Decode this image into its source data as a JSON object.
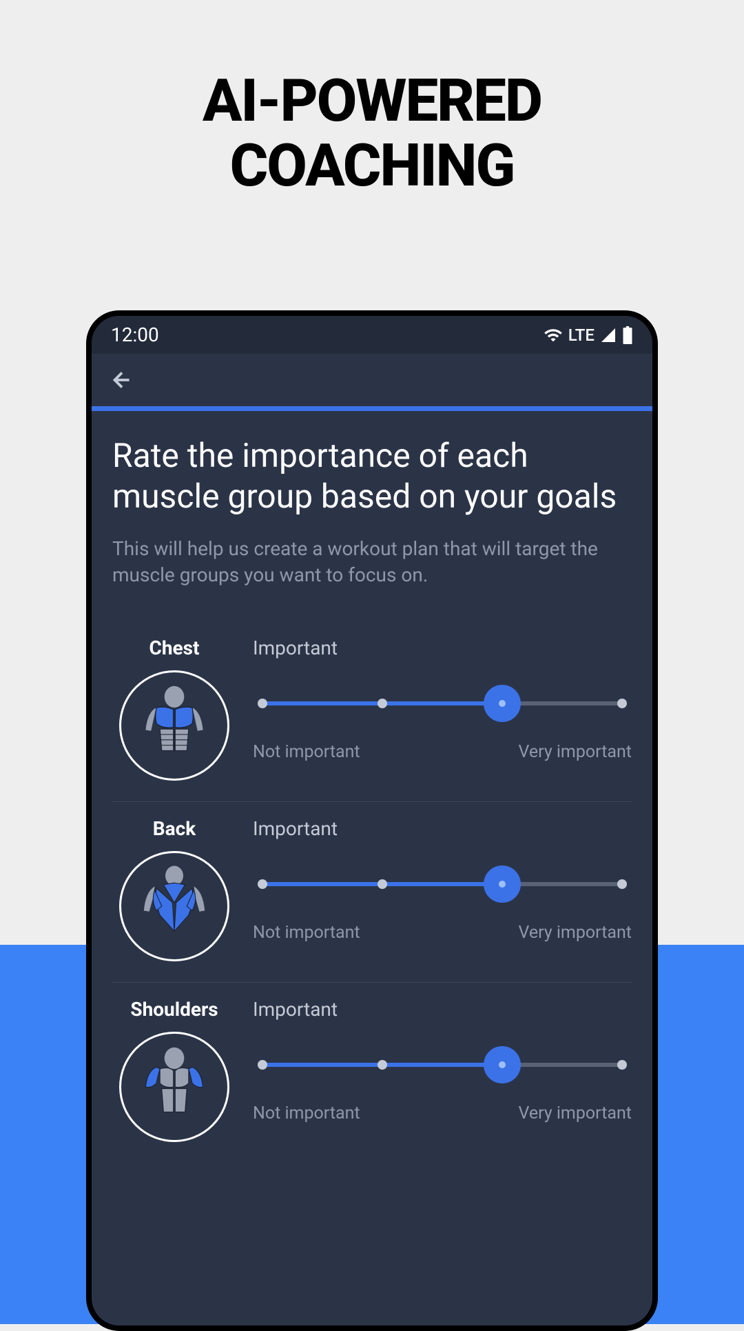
{
  "promo": {
    "title_line1": "AI-POWERED",
    "title_line2": "COACHING"
  },
  "status_bar": {
    "time": "12:00",
    "network": "LTE"
  },
  "screen": {
    "heading": "Rate the importance of each muscle group based on your goals",
    "subtitle": "This will help us create a workout plan that will target the muscle groups you want to focus on.",
    "slider_min_label": "Not important",
    "slider_max_label": "Very important"
  },
  "muscles": [
    {
      "name": "Chest",
      "level_label": "Important",
      "value": 2,
      "max": 3
    },
    {
      "name": "Back",
      "level_label": "Important",
      "value": 2,
      "max": 3
    },
    {
      "name": "Shoulders",
      "level_label": "Important",
      "value": 2,
      "max": 3
    }
  ]
}
